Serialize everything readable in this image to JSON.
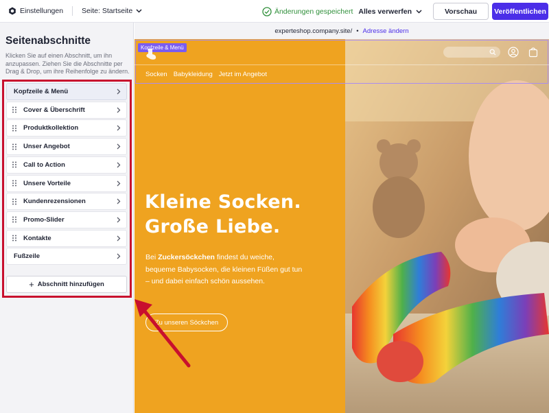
{
  "topbar": {
    "settings_label": "Einstellungen",
    "page_selector": "Seite: Startseite",
    "save_status": "Änderungen gespeichert",
    "discard_label": "Alles verwerfen",
    "preview_label": "Vorschau",
    "publish_label": "Veröffentlichen"
  },
  "sidebar": {
    "title": "Seitenabschnitte",
    "description": "Klicken Sie auf einen Abschnitt, um ihn anzupassen. Ziehen Sie die Abschnitte per Drag & Drop, um ihre Reihenfolge zu ändern.",
    "sections": [
      {
        "label": "Kopfzeile & Menü",
        "draggable": false
      },
      {
        "label": "Cover & Überschrift",
        "draggable": true
      },
      {
        "label": "Produktkollektion",
        "draggable": true
      },
      {
        "label": "Unser Angebot",
        "draggable": true
      },
      {
        "label": "Call to Action",
        "draggable": true
      },
      {
        "label": "Unsere Vorteile",
        "draggable": true
      },
      {
        "label": "Kundenrezensionen",
        "draggable": true
      },
      {
        "label": "Promo-Slider",
        "draggable": true
      },
      {
        "label": "Kontakte",
        "draggable": true
      },
      {
        "label": "Fußzeile",
        "draggable": false
      }
    ],
    "add_section_label": "Abschnitt hinzufügen"
  },
  "address_bar": {
    "url": "experteshop.company.site/",
    "separator": "•",
    "change_link": "Adresse ändern"
  },
  "preview": {
    "header_tag": "Kopfzeile & Menü",
    "nav_items": [
      "Socken",
      "Babykleidung",
      "Jetzt im Angebot"
    ],
    "headline_line1": "Kleine Socken.",
    "headline_line2": "Große Liebe.",
    "subtext_prefix": "Bei ",
    "subtext_brand": "Zuckersöckchen",
    "subtext_rest": " findest du weiche, bequeme Babysocken, die kleinen Füßen gut tun – und dabei einfach schön aussehen.",
    "cta_label": "Zu unseren Söckchen"
  },
  "colors": {
    "accent": "#4b2ee8",
    "hero_orange": "#efa320",
    "success": "#2f8f3a",
    "annotation_red": "#c8102e"
  },
  "icons": [
    "gear-icon",
    "chevron-down-icon",
    "check-circle-icon",
    "drag-handle-icon",
    "chevron-right-icon",
    "plus-icon",
    "search-icon",
    "user-icon",
    "shopping-bag-icon"
  ]
}
